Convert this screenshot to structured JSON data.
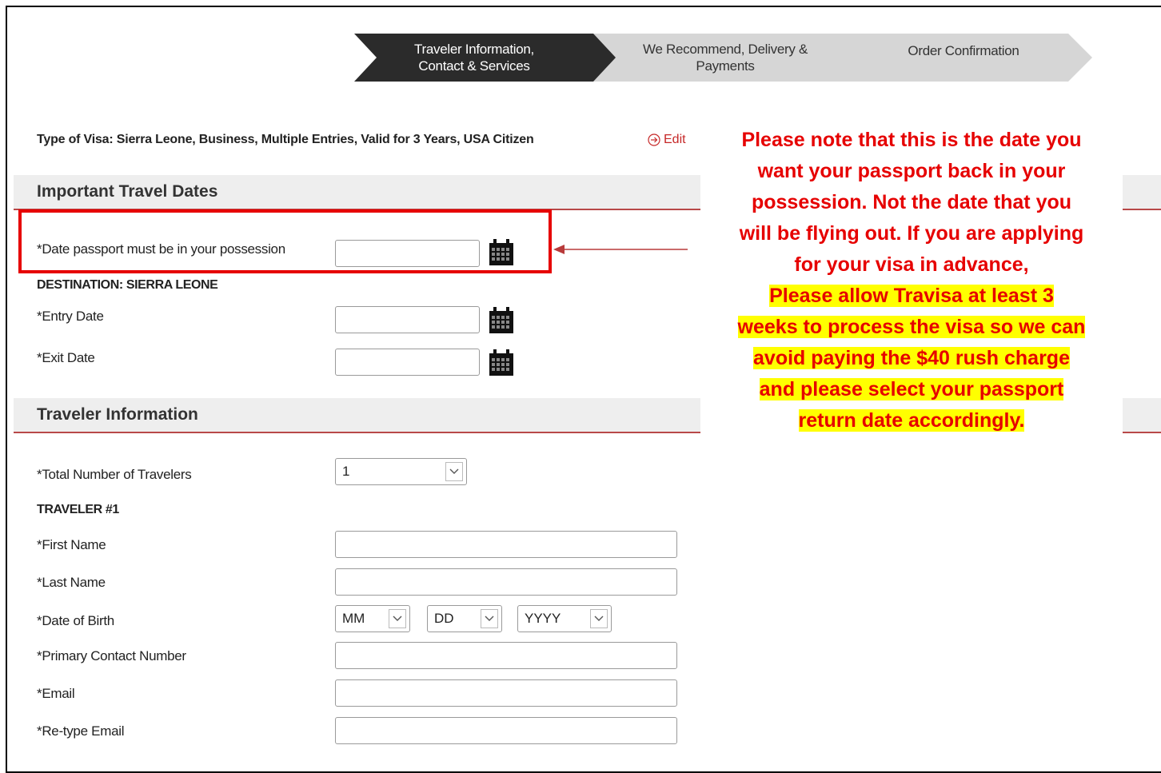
{
  "stepper": {
    "steps": [
      {
        "line1": "Traveler Information,",
        "line2": "Contact & Services",
        "active": true
      },
      {
        "line1": "We Recommend, Delivery &",
        "line2": "Payments",
        "active": false
      },
      {
        "line1": "Order Confirmation",
        "line2": "",
        "active": false
      }
    ]
  },
  "visa": {
    "type_text": "Type of Visa: Sierra Leone, Business, Multiple Entries, Valid for 3 Years, USA Citizen",
    "edit_label": "Edit"
  },
  "travel_dates": {
    "heading": "Important Travel Dates",
    "passport_date_label": "*Date passport must be in your possession",
    "destination_heading": "DESTINATION: SIERRA LEONE",
    "entry_label": "*Entry Date",
    "exit_label": "*Exit Date"
  },
  "traveler": {
    "heading": "Traveler Information",
    "total_label": "*Total Number of Travelers",
    "total_value": "1",
    "traveler_heading": "TRAVELER #1",
    "first_name_label": "*First Name",
    "last_name_label": "*Last Name",
    "dob_label": "*Date of Birth",
    "dob_month": "MM",
    "dob_day": "DD",
    "dob_year": "YYYY",
    "phone_label": "*Primary Contact Number",
    "email_label": "*Email",
    "retype_email_label": "*Re-type Email"
  },
  "annotation": {
    "note_lines": [
      "Please note that this is the date you",
      "want your passport back in your",
      "possession. Not the date that you",
      "will be flying out. If you are applying",
      "for your visa in advance,"
    ],
    "highlight_lines": [
      "Please allow Travisa at least 3",
      "weeks to process the visa so we can",
      "avoid paying the $40 rush charge",
      "and please select your passport",
      "return date accordingly."
    ],
    "color": "#e60000",
    "highlight_color": "#ffff00"
  },
  "colors": {
    "active_step": "#2b2b2b",
    "inactive_step": "#d6d6d6",
    "section_rule": "#b84848",
    "section_bg": "#eeeeee"
  }
}
